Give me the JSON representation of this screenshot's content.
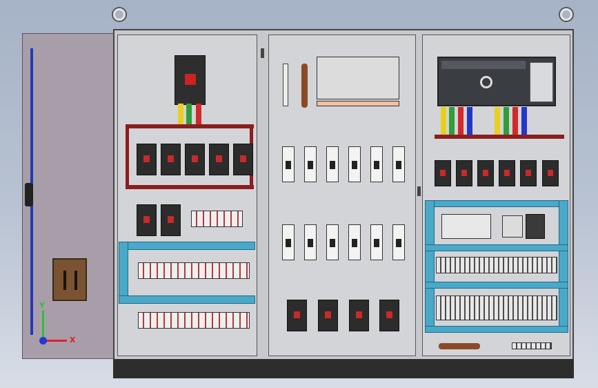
{
  "axis_triad": {
    "x_label": "X",
    "y_label": "Y",
    "x_color": "#e0202a",
    "y_color": "#2fbf3a",
    "z_color": "#2438d6"
  },
  "colors": {
    "busbar": "#8b1e1e",
    "wire_yellow": "#e8d020",
    "wire_green": "#2f9e3a",
    "wire_red": "#d22a2a",
    "wire_blue": "#2338c8",
    "cable_trunking": "#4aa8c8",
    "door": "#a79ea9",
    "plc_body": "#3a3d42"
  },
  "icons": [
    "lifting-eye-icon",
    "circuit-breaker-icon",
    "fuse-holder-icon",
    "terminal-block-icon",
    "plc-module-icon",
    "axis-triad-icon"
  ]
}
